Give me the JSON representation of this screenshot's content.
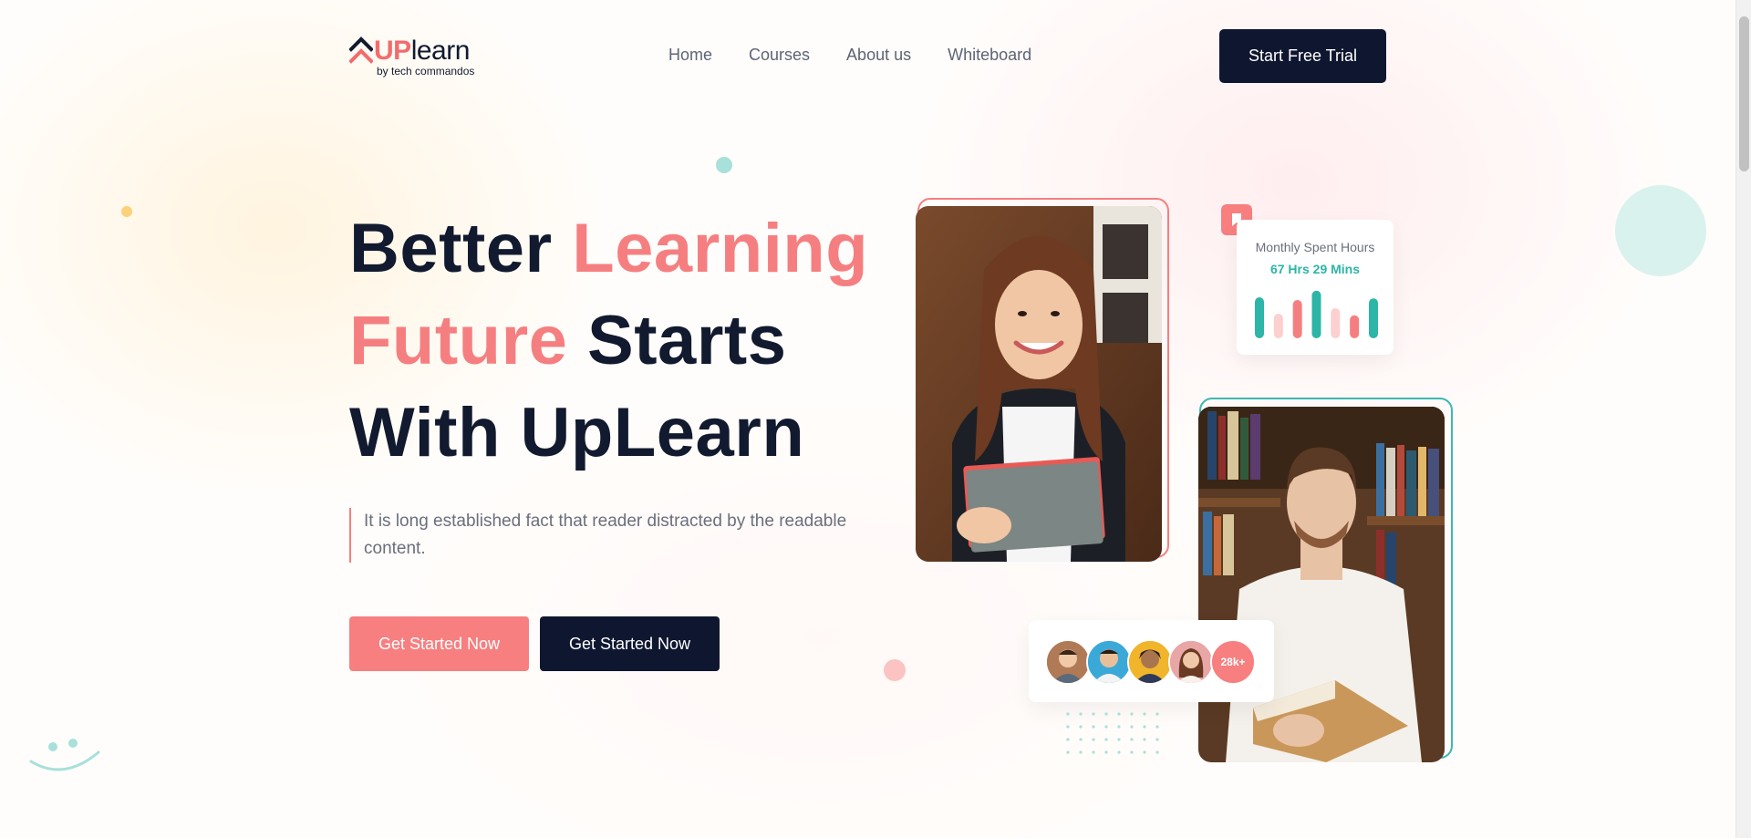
{
  "brand": {
    "logo_up": "UP",
    "logo_learn": "learn",
    "logo_byline": "by  tech commandos"
  },
  "nav": {
    "items": [
      {
        "label": "Home"
      },
      {
        "label": "Courses"
      },
      {
        "label": "About us"
      },
      {
        "label": "Whiteboard"
      }
    ],
    "cta_label": "Start Free Trial"
  },
  "hero": {
    "headline_part1": "Better ",
    "headline_accent1": "Learning",
    "headline_accent2": "Future",
    "headline_part2": " Starts",
    "headline_line3": "With UpLearn",
    "tagline": "It is long established fact that reader distracted by the readable content.",
    "primary_button": "Get Started Now",
    "secondary_button": "Get Started Now"
  },
  "stats_card": {
    "label": "Monthly Spent Hours",
    "value": "67 Hrs 29 Mins",
    "bar_levels": [
      0.75,
      0.45,
      0.7,
      0.87,
      0.55,
      0.42,
      0.73
    ],
    "bar_colors": [
      "#2db5a7",
      "#fbd0cf",
      "#f57f80",
      "#2db5a7",
      "#fbd0cf",
      "#f57f80",
      "#2db5a7"
    ],
    "badge_icon": "bookmark-icon"
  },
  "students": {
    "count_label": "28k+",
    "avatar_icons": [
      "avatar-icon",
      "avatar-icon",
      "avatar-icon",
      "avatar-icon"
    ]
  },
  "colors": {
    "accent": "#f57f80",
    "dark": "#0f1730",
    "teal": "#2db5a7"
  }
}
